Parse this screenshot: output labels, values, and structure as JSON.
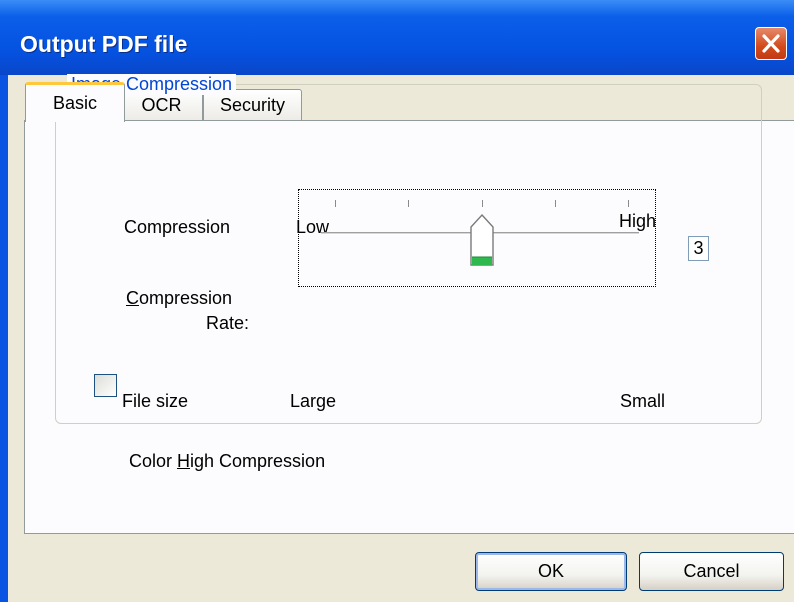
{
  "dialog": {
    "title": "Output PDF file",
    "accent": "#0b54e3",
    "close_color": "#d24a1b"
  },
  "tabs": [
    {
      "label": "Basic",
      "active": true
    },
    {
      "label": "OCR",
      "active": false
    },
    {
      "label": "Security",
      "active": false
    }
  ],
  "group": {
    "legend": "Image Compression",
    "compression_label": "Compression",
    "low_label": "Low",
    "high_label": "High",
    "rate_label_line1_mnemonic": "C",
    "rate_label_line1_rest": "ompression",
    "rate_label_line2": "Rate:",
    "slider": {
      "min": 1,
      "max": 5,
      "value": 3,
      "ticks": 5
    },
    "rate_value": "3",
    "file_size_label": "File size",
    "large_label": "Large",
    "small_label": "Small",
    "checkbox": {
      "label_prefix": "Color ",
      "label_mnemonic": "H",
      "label_rest": "igh Compression",
      "checked": false
    }
  },
  "buttons": {
    "ok": "OK",
    "cancel": "Cancel"
  }
}
